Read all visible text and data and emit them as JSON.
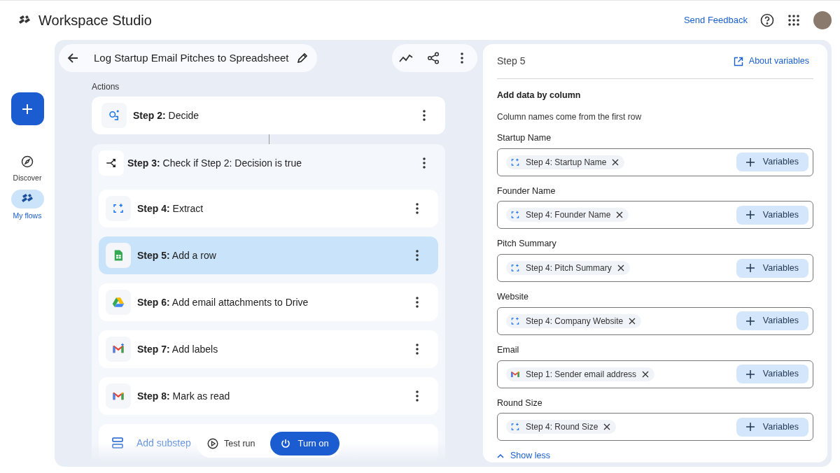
{
  "app": {
    "title": "Workspace Studio",
    "feedback": "Send Feedback"
  },
  "rail": {
    "items": [
      {
        "label": "Discover",
        "kind": "compass",
        "selected": false
      },
      {
        "label": "My flows",
        "kind": "flows",
        "selected": true
      }
    ]
  },
  "flow": {
    "title": "Log Startup Email Pitches to Spreadsheet",
    "section": "Actions",
    "steps": [
      {
        "text": "**Step 2:** Decide",
        "kind": "assistant",
        "selected": false
      },
      {
        "text": "**Step 3:** Check if Step 2: Decision is true",
        "kind": "branch",
        "selected": false,
        "children": [
          {
            "text": "**Step 4:** Extract",
            "kind": "extract",
            "selected": false
          },
          {
            "text": "**Step 5:** Add a row",
            "kind": "sheets",
            "selected": true
          },
          {
            "text": "**Step 6:** Add email attachments to Drive",
            "kind": "drive",
            "selected": false
          },
          {
            "text": "**Step 7:** Add labels",
            "kind": "gmail-ai",
            "selected": false
          },
          {
            "text": "**Step 8:** Mark as read",
            "kind": "gmail",
            "selected": false
          }
        ],
        "add": "Add substep"
      }
    ],
    "test_run": "Test run",
    "turn_on": "Turn on"
  },
  "panel": {
    "title": "Step 5",
    "about": "About variables",
    "heading": "Add data by column",
    "description": "Column names come from the first row",
    "fields": [
      {
        "label": "Startup Name",
        "chip": "Step 4: Startup Name",
        "kind": "extract",
        "button": "Variables"
      },
      {
        "label": "Founder Name",
        "chip": "Step 4: Founder Name",
        "kind": "extract",
        "button": "Variables"
      },
      {
        "label": "Pitch Summary",
        "chip": "Step 4: Pitch Summary",
        "kind": "extract",
        "button": "Variables"
      },
      {
        "label": "Website",
        "chip": "Step 4: Company Website",
        "kind": "extract",
        "button": "Variables"
      },
      {
        "label": "Email",
        "chip": "Step 1: Sender email address",
        "kind": "gmail",
        "button": "Variables"
      },
      {
        "label": "Round Size",
        "chip": "Step 4: Round Size",
        "kind": "extract",
        "button": "Variables"
      }
    ],
    "show_less": "Show less"
  }
}
